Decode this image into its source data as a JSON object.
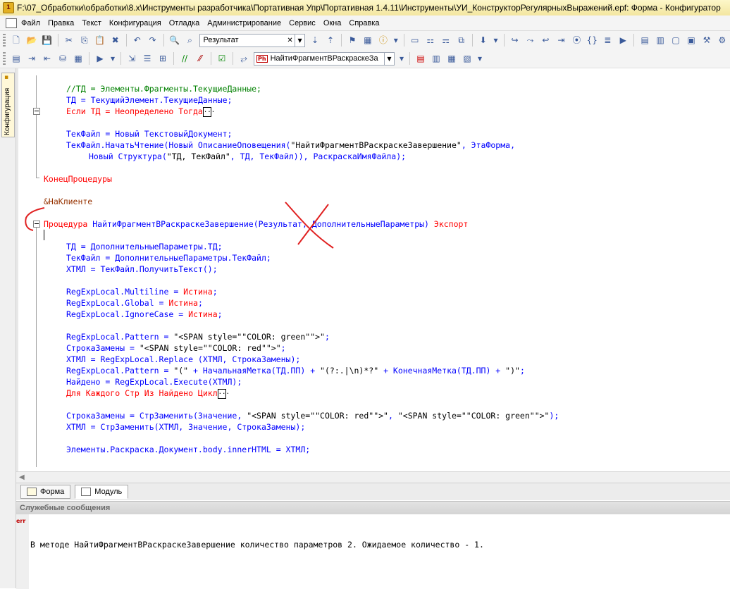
{
  "window": {
    "title": "F:\\07_Обработки\\обработки\\8.x\\Инструменты разработчика\\Портативная Упр\\Портативная 1.4.11\\Инструменты\\УИ_КонструкторРегулярныхВыражений.epf: Форма - Конфигуратор"
  },
  "menu": [
    "Файл",
    "Правка",
    "Текст",
    "Конфигурация",
    "Отладка",
    "Администрирование",
    "Сервис",
    "Окна",
    "Справка"
  ],
  "toolbar": {
    "search_value": "Результат",
    "procedure_value": "НайтиФрагментВРаскраскеЗа",
    "procedure_icon": "Ph"
  },
  "sidepanel": {
    "tab_label": "Конфигурация"
  },
  "code": {
    "l1": "//ТД = Элементы.Фрагменты.ТекущиеДанные;",
    "l2a": "ТД",
    "l2b": " = ",
    "l2c": "ТекущийЭлемент.ТекущиеДанные;",
    "l3a": "Если ТД = Неопределено Тогда",
    "l3b": "...",
    "l4a": "ТекФайл",
    "l4b": " = ",
    "l4c": "Новый ТекстовыйДокумент;",
    "l5a": "ТекФайл.НачатьЧтение(Новый ОписаниеОповещения(",
    "l5b": "\"НайтиФрагментВРаскраскеЗавершение\"",
    "l5c": ", ЭтаФорма,",
    "l6a": "Новый Структура(",
    "l6b": "\"ТД, ТекФайл\"",
    "l6c": ", ТД, ТекФайл)), РаскраскаИмяФайла);",
    "l7": "КонецПроцедуры",
    "l8": "&НаКлиенте",
    "l9a": "Процедура",
    "l9b": " НайтиФрагментВРаскраскеЗавершение(Результат, ДополнительныеПараметры) ",
    "l9c": "Экспорт",
    "l10": "ТД = ДополнительныеПараметры.ТД;",
    "l11": "ТекФайл = ДополнительныеПараметры.ТекФайл;",
    "l12": "ХТМЛ = ТекФайл.ПолучитьТекст();",
    "l13a": "RegExpLocal.Multiline = ",
    "l13b": "Истина",
    "l13c": ";",
    "l14a": "RegExpLocal.Global = ",
    "l14b": "Истина",
    "l14c": ";",
    "l15a": "RegExpLocal.IgnoreCase = ",
    "l15b": "Истина",
    "l15c": ";",
    "l16a": "RegExpLocal.Pattern = ",
    "l16b": "\"<SPAN style=\"\"COLOR: green\"\">\"",
    "l16c": ";",
    "l17a": "СтрокаЗамены = ",
    "l17b": "\"<SPAN style=\"\"COLOR: red\"\">\"",
    "l17c": ";",
    "l18": "ХТМЛ = RegExpLocal.Replace (ХТМЛ, СтрокаЗамены);",
    "l19a": "RegExpLocal.Pattern = ",
    "l19b": "\"(\"",
    "l19c": " + НачальнаяМетка(ТД.ПП) + ",
    "l19d": "\"(?:.|\\n)*?\"",
    "l19e": " + КонечнаяМетка(ТД.ПП) + ",
    "l19f": "\")\"",
    "l19g": ";",
    "l20": "Найдено = RegExpLocal.Execute(ХТМЛ);",
    "l21a": "Для Каждого Стр Из Найдено Цикл",
    "l21b": "...",
    "l22a": "СтрокаЗамены = СтрЗаменить(Значение, ",
    "l22b": "\"<SPAN style=\"\"COLOR: red\"\">\"",
    "l22c": ", ",
    "l22d": "\"<SPAN style=\"\"COLOR: green\"\">\"",
    "l22e": ");",
    "l23": "ХТМЛ = СтрЗаменить(ХТМЛ, Значение, СтрокаЗамены);",
    "l24": "Элементы.Раскраска.Документ.body.innerHTML = ХТМЛ;"
  },
  "tabs": [
    "Форма",
    "Модуль"
  ],
  "messages": {
    "header": "Служебные сообщения",
    "rows": [
      {
        "marker": "err",
        "text": "В методе НайтиФрагментВРаскраскеЗавершение количество параметров 2. Ожидаемое количество - 1."
      }
    ]
  }
}
